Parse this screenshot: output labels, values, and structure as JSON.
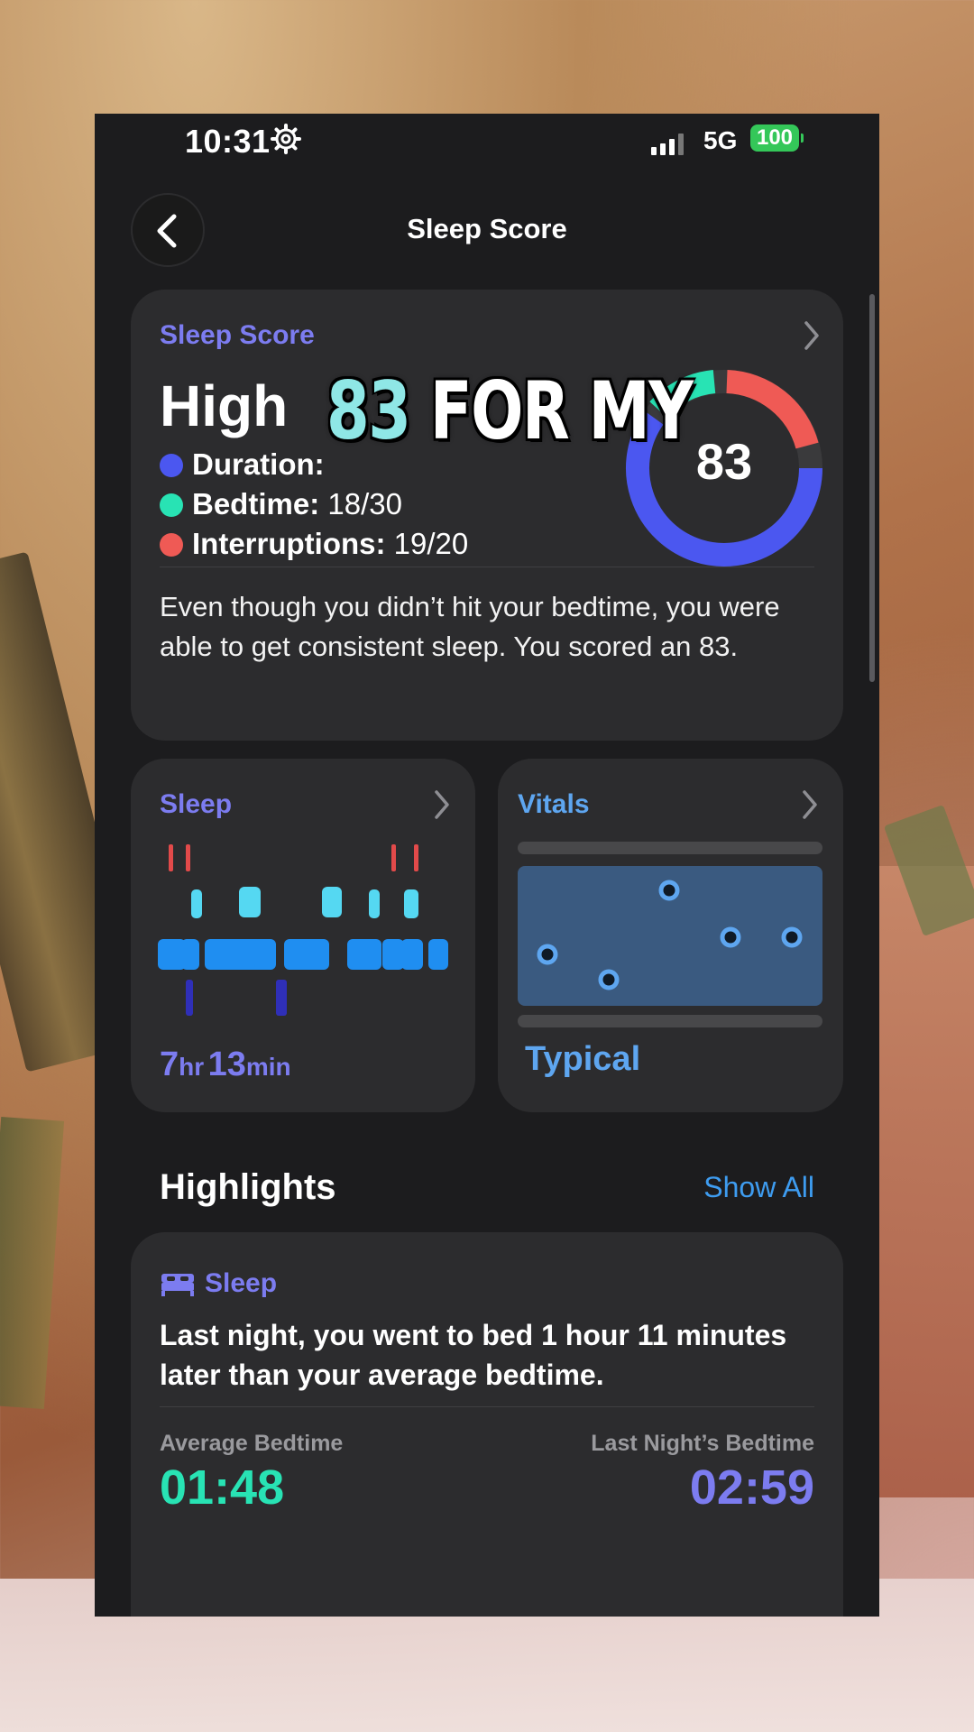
{
  "status_bar": {
    "time": "10:31",
    "network": "5G",
    "battery": "100"
  },
  "nav": {
    "title": "Sleep Score"
  },
  "score_card": {
    "label": "Sleep Score",
    "level": "High",
    "metrics": [
      {
        "name": "Duration:",
        "value": "",
        "color": "#4b57f0"
      },
      {
        "name": "Bedtime:",
        "value": "18/30",
        "color": "#28e3b4"
      },
      {
        "name": "Interruptions:",
        "value": "19/20",
        "color": "#ef5a55"
      }
    ],
    "score": "83",
    "summary": "Even though you didn’t hit your bedtime, you were able to get consistent sleep. You scored an 83.",
    "ring_colors": {
      "duration": "#4b57f0",
      "bedtime": "#28e3b4",
      "interruptions": "#ef5a55"
    }
  },
  "overlay_caption": {
    "number": "83",
    "text": " FOR MY"
  },
  "sleep_card": {
    "label": "Sleep",
    "hours": "7",
    "hours_unit": "hr",
    "minutes": "13",
    "minutes_unit": "min"
  },
  "vitals_card": {
    "label": "Vitals",
    "status": "Typical"
  },
  "highlights": {
    "title": "Highlights",
    "show_all": "Show All",
    "card": {
      "tag": "Sleep",
      "text": "Last night, you went to bed 1 hour 11 minutes later than your average bedtime.",
      "average_label": "Average Bedtime",
      "average_value": "01:48",
      "last_label": "Last Night’s Bedtime",
      "last_value": "02:59",
      "average_color": "#28e3b4",
      "last_color": "#7c7cf0"
    }
  }
}
